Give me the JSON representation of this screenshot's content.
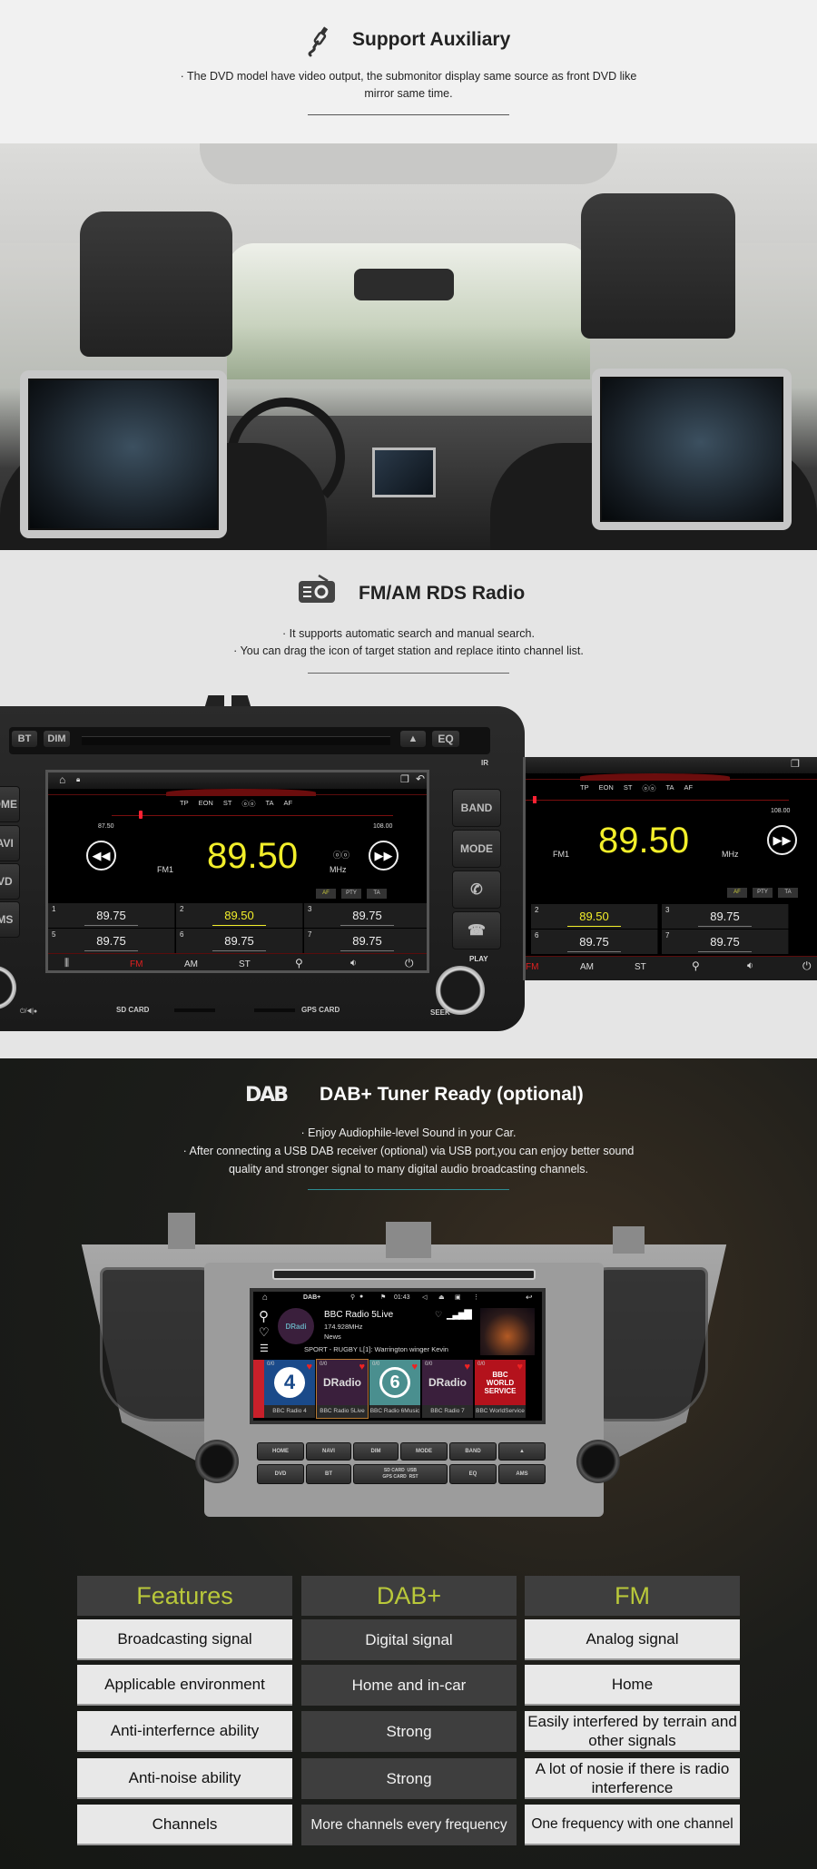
{
  "aux": {
    "icon": "aux-cable-icon",
    "title": "Support Auxiliary",
    "desc_line1": "· The DVD model have video output, the submonitor display same source as front DVD like",
    "desc_line2": "mirror same time."
  },
  "photo": {
    "alt": "Car interior with two headrest monitors mirroring the front DVD screen"
  },
  "radio": {
    "icon": "radio-icon",
    "title": "FM/AM RDS Radio",
    "desc_line1": "· It supports automatic search and manual search.",
    "desc_line2": "· You can drag the icon of target station and replace itinto channel list.",
    "unit": {
      "top_buttons": [
        "BT",
        "DIM",
        "▲",
        "EQ"
      ],
      "ir_label": "IR",
      "left_buttons": [
        "HOME",
        "NAVI",
        "DVD",
        "AMS"
      ],
      "right_buttons": [
        "BAND",
        "MODE"
      ],
      "play_label": "PLAY",
      "seek_label": "SEEK",
      "sd_label": "SD CARD",
      "gps_label": "GPS CARD",
      "power_label": "⏻/◀|●",
      "rds_flags": [
        "TP",
        "EON",
        "ST",
        "ⓞⓞ",
        "TA",
        "AF"
      ],
      "range_min": "87.50",
      "range_max": "108.00",
      "band": "FM1",
      "frequency": "89.50",
      "unit_label": "MHz",
      "tuning_position": 0.098,
      "toggles": [
        "AF",
        "PTY",
        "TA"
      ],
      "presets": [
        {
          "num": "1",
          "freq": "89.75",
          "active": false
        },
        {
          "num": "2",
          "freq": "89.50",
          "active": true
        },
        {
          "num": "3",
          "freq": "89.75",
          "active": false
        },
        {
          "num": "5",
          "freq": "89.75",
          "active": false
        },
        {
          "num": "6",
          "freq": "89.75",
          "active": false
        },
        {
          "num": "7",
          "freq": "89.75",
          "active": false
        }
      ],
      "bottom_bar": [
        "EQ-icon",
        "FM",
        "AM",
        "ST",
        "search-icon",
        "volume-icon",
        "power-icon"
      ],
      "bottom_labels": {
        "fm": "FM",
        "am": "AM",
        "st": "ST"
      }
    }
  },
  "dab": {
    "icon": "dab-logo",
    "logo_text": "DAB",
    "title": "DAB+ Tuner Ready (optional)",
    "desc_line1": "· Enjoy Audiophile-level Sound in your Car.",
    "desc_line2": "· After connecting a USB DAB receiver (optional) via USB port,you can enjoy better sound",
    "desc_line3": "quality and stronger signal to many digital audio broadcasting channels.",
    "screen": {
      "app": "DAB+",
      "time": "01:43",
      "station": "BBC Radio 5Live",
      "frequency": "174.928MHz",
      "genre": "News",
      "ticker": "SPORT - RUGBY L[1]: Warrington winger Kevin",
      "logo_text": "DRadi",
      "tiles": [
        {
          "name": "BBC Radio 4",
          "count": "0/0",
          "art": "4"
        },
        {
          "name": "BBC Radio 5Live",
          "count": "0/0",
          "art": "DRadio"
        },
        {
          "name": "BBC Radio 6Music",
          "count": "0/0",
          "art": "6"
        },
        {
          "name": "BBC Radio 7",
          "count": "0/0",
          "art": "DRadio"
        },
        {
          "name": "BBC WorldService",
          "count": "0/0",
          "art": "BBC WORLD SERVICE"
        }
      ]
    },
    "hw_buttons_row1": [
      "HOME",
      "NAVI",
      "DIM",
      "MODE",
      "BAND",
      "▲"
    ],
    "hw_buttons_row2": [
      "DVD",
      "BT",
      "SD CARD  USB\nGPS CARD  RST",
      "EQ",
      "AMS"
    ]
  },
  "comparison": {
    "headers": [
      "Features",
      "DAB+",
      "FM"
    ],
    "rows": [
      [
        "Broadcasting signal",
        "Digital signal",
        "Analog signal"
      ],
      [
        "Applicable environment",
        "Home and in-car",
        "Home"
      ],
      [
        "Anti-interfernce ability",
        "Strong",
        "Easily interfered by terrain and other signals"
      ],
      [
        "Anti-noise ability",
        "Strong",
        "A lot of nosie if there is radio interference"
      ],
      [
        "Channels",
        "More channels every frequency",
        "One frequency with one channel"
      ]
    ]
  },
  "colors": {
    "accent_yellow": "#f2ee2a",
    "table_header_text": "#b9c83a",
    "fm_red": "#e02020",
    "divider_teal": "#2d8d92"
  }
}
